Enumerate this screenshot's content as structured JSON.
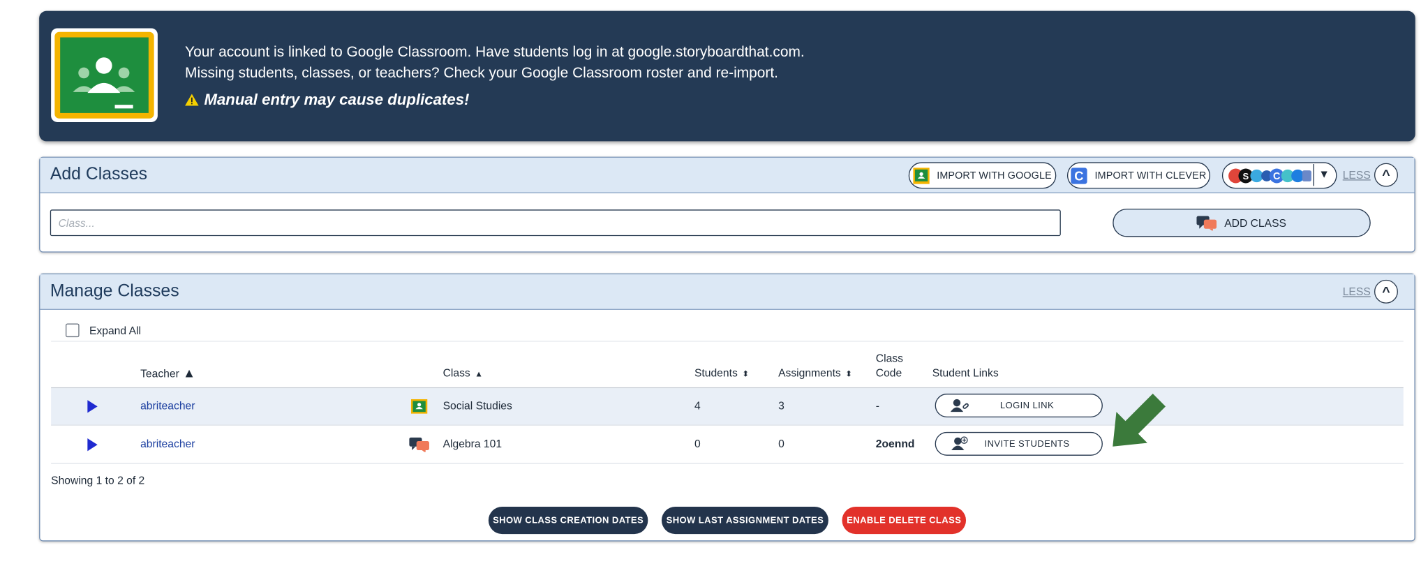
{
  "banner": {
    "line1": "Your account is linked to Google Classroom. Have students log in at google.storyboardthat.com.",
    "line2": "Missing students, classes, or teachers? Check your Google Classroom roster and re-import.",
    "warning": "Manual entry may cause duplicates!",
    "logo_icon": "google-classroom-logo"
  },
  "add_classes": {
    "title": "Add Classes",
    "import_google_label": "IMPORT WITH GOOGLE",
    "import_clever_label": "IMPORT WITH CLEVER",
    "less_label": "LESS",
    "class_placeholder": "Class...",
    "add_class_label": "ADD CLASS"
  },
  "manage_classes": {
    "title": "Manage Classes",
    "less_label": "LESS",
    "expand_all_label": "Expand All",
    "columns": {
      "teacher": "Teacher",
      "class": "Class",
      "students": "Students",
      "assignments": "Assignments",
      "class_code_1": "Class",
      "class_code_2": "Code",
      "student_links": "Student Links"
    },
    "rows": [
      {
        "teacher": "abriteacher",
        "class_icon": "google-classroom-icon",
        "class": "Social Studies",
        "students": "4",
        "assignments": "3",
        "class_code": "-",
        "link_label": "LOGIN LINK"
      },
      {
        "teacher": "abriteacher",
        "class_icon": "chat-bubbles-icon",
        "class": "Algebra 101",
        "students": "0",
        "assignments": "0",
        "class_code": "2oennd",
        "link_label": "INVITE STUDENTS"
      }
    ],
    "showing": "Showing 1 to 2 of 2",
    "buttons": {
      "show_creation": "SHOW CLASS CREATION DATES",
      "show_last_assignment": "SHOW LAST ASSIGNMENT DATES",
      "enable_delete": "ENABLE DELETE CLASS"
    }
  },
  "colors": {
    "banner_bg": "#243a55",
    "panel_header_bg": "#dce8f5",
    "navy_button": "#23344c",
    "delete_red": "#e2312a",
    "link_blue": "#1c3fa0",
    "arrow_green": "#3b7a3b"
  }
}
